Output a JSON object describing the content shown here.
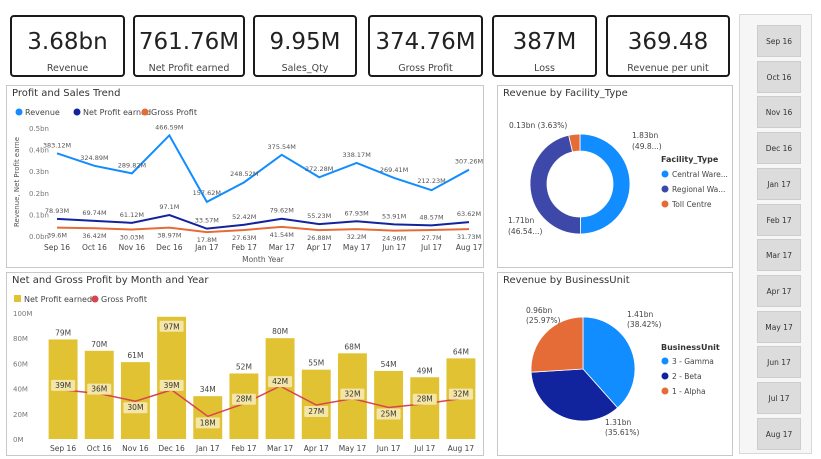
{
  "kpis": [
    {
      "value": "3.68bn",
      "label": "Revenue"
    },
    {
      "value": "761.76M",
      "label": "Net Profit earned"
    },
    {
      "value": "9.95M",
      "label": "Sales_Qty"
    },
    {
      "value": "374.76M",
      "label": "Gross Profit"
    },
    {
      "value": "387M",
      "label": "Loss"
    },
    {
      "value": "369.48",
      "label": "Revenue per unit"
    }
  ],
  "months": [
    "Sep 16",
    "Oct 16",
    "Nov 16",
    "Dec 16",
    "Jan 17",
    "Feb 17",
    "Mar 17",
    "Apr 17",
    "May 17",
    "Jun 17",
    "Jul 17",
    "Aug 17"
  ],
  "slicer": {
    "items": [
      "Sep 16",
      "Oct 16",
      "Nov 16",
      "Dec 16",
      "Jan 17",
      "Feb 17",
      "Mar 17",
      "Apr 17",
      "May 17",
      "Jun 17",
      "Jul 17",
      "Aug 17"
    ]
  },
  "colors": {
    "revenue": "#118DFF",
    "net_profit": "#12239E",
    "gross_profit": "#E66C37",
    "bar": "#E1C233",
    "gold_line": "#D64550",
    "central": "#118DFF",
    "regional": "#3D48A8",
    "toll": "#E66C37",
    "gamma": "#118DFF",
    "beta": "#12239E",
    "alpha": "#E66C37"
  },
  "chart_data": [
    {
      "type": "line",
      "title": "Profit and Sales Trend",
      "xlabel": "Month Year",
      "ylabel": "Revenue, Net Profit earne",
      "ylim": [
        0,
        0.5
      ],
      "y_ticks": [
        "0.0bn",
        "0.1bn",
        "0.2bn",
        "0.3bn",
        "0.4bn",
        "0.5bn"
      ],
      "legend": "top-left",
      "categories": [
        "Sep 16",
        "Oct 16",
        "Nov 16",
        "Dec 16",
        "Jan 17",
        "Feb 17",
        "Mar 17",
        "Apr 17",
        "May 17",
        "Jun 17",
        "Jul 17",
        "Aug 17"
      ],
      "series": [
        {
          "name": "Revenue",
          "values": [
            0.383,
            0.325,
            0.29,
            0.466,
            0.158,
            0.249,
            0.376,
            0.272,
            0.338,
            0.269,
            0.212,
            0.307
          ],
          "labels": [
            "383.12M",
            "324.89M",
            "289.82M",
            "466.59M",
            "157.62M",
            "248.52M",
            "375.54M",
            "272.28M",
            "338.17M",
            "269.41M",
            "212.23M",
            "307.26M"
          ]
        },
        {
          "name": "Net Profit earned",
          "values": [
            0.079,
            0.07,
            0.061,
            0.097,
            0.034,
            0.052,
            0.08,
            0.055,
            0.068,
            0.054,
            0.049,
            0.064
          ],
          "labels": [
            "78.93M",
            "69.74M",
            "61.12M",
            "97.1M",
            "33.57M",
            "52.42M",
            "79.62M",
            "55.23M",
            "67.93M",
            "53.91M",
            "48.57M",
            "63.62M"
          ]
        },
        {
          "name": "Gross Profit",
          "values": [
            0.039,
            0.036,
            0.03,
            0.039,
            0.018,
            0.028,
            0.042,
            0.027,
            0.032,
            0.025,
            0.028,
            0.032
          ],
          "labels": [
            "39.6M",
            "36.42M",
            "30.03M",
            "38.97M",
            "17.8M",
            "27.63M",
            "41.54M",
            "26.88M",
            "32.2M",
            "24.96M",
            "27.7M",
            "31.73M"
          ]
        }
      ]
    },
    {
      "type": "bar",
      "title": "Net and Gross Profit by Month and Year",
      "legend": "top-left",
      "ylim": [
        0,
        100
      ],
      "y_ticks": [
        "0M",
        "20M",
        "40M",
        "60M",
        "80M",
        "100M"
      ],
      "categories": [
        "Sep 16",
        "Oct 16",
        "Nov 16",
        "Dec 16",
        "Jan 17",
        "Feb 17",
        "Mar 17",
        "Apr 17",
        "May 17",
        "Jun 17",
        "Jul 17",
        "Aug 17"
      ],
      "series": [
        {
          "name": "Net Profit earned",
          "values": [
            79,
            70,
            61,
            97,
            34,
            52,
            80,
            55,
            68,
            54,
            49,
            64
          ],
          "labels": [
            "79M",
            "70M",
            "61M",
            "97M",
            "34M",
            "52M",
            "80M",
            "55M",
            "68M",
            "54M",
            "49M",
            "64M"
          ]
        },
        {
          "name": "Gross Profit",
          "values": [
            39,
            36,
            30,
            39,
            18,
            28,
            42,
            27,
            32,
            25,
            28,
            32
          ],
          "labels": [
            "39M",
            "36M",
            "30M",
            "39M",
            "18M",
            "28M",
            "42M",
            "27M",
            "32M",
            "25M",
            "28M",
            "32M"
          ]
        }
      ]
    },
    {
      "type": "pie",
      "donut": true,
      "title": "Revenue by Facility_Type",
      "legend_title": "Facility_Type",
      "legend": "right",
      "slices": [
        {
          "name": "Central Ware...",
          "value": 1.83,
          "percent": 49.8,
          "label": "1.83bn\n(49.8...)"
        },
        {
          "name": "Regional Wa...",
          "value": 1.71,
          "percent": 46.54,
          "label": "1.71bn\n(46.54...)"
        },
        {
          "name": "Toll Centre",
          "value": 0.13,
          "percent": 3.63,
          "label": "0.13bn (3.63%)"
        }
      ]
    },
    {
      "type": "pie",
      "title": "Revenue by BusinessUnit",
      "legend_title": "BusinessUnit",
      "legend": "right",
      "slices": [
        {
          "name": "3 - Gamma",
          "value": 1.41,
          "percent": 38.42,
          "label": "1.41bn\n(38.42%)"
        },
        {
          "name": "2 - Beta",
          "value": 1.31,
          "percent": 35.61,
          "label": "1.31bn\n(35.61%)"
        },
        {
          "name": "1 - Alpha",
          "value": 0.96,
          "percent": 25.97,
          "label": "0.96bn\n(25.97%)"
        }
      ]
    }
  ]
}
